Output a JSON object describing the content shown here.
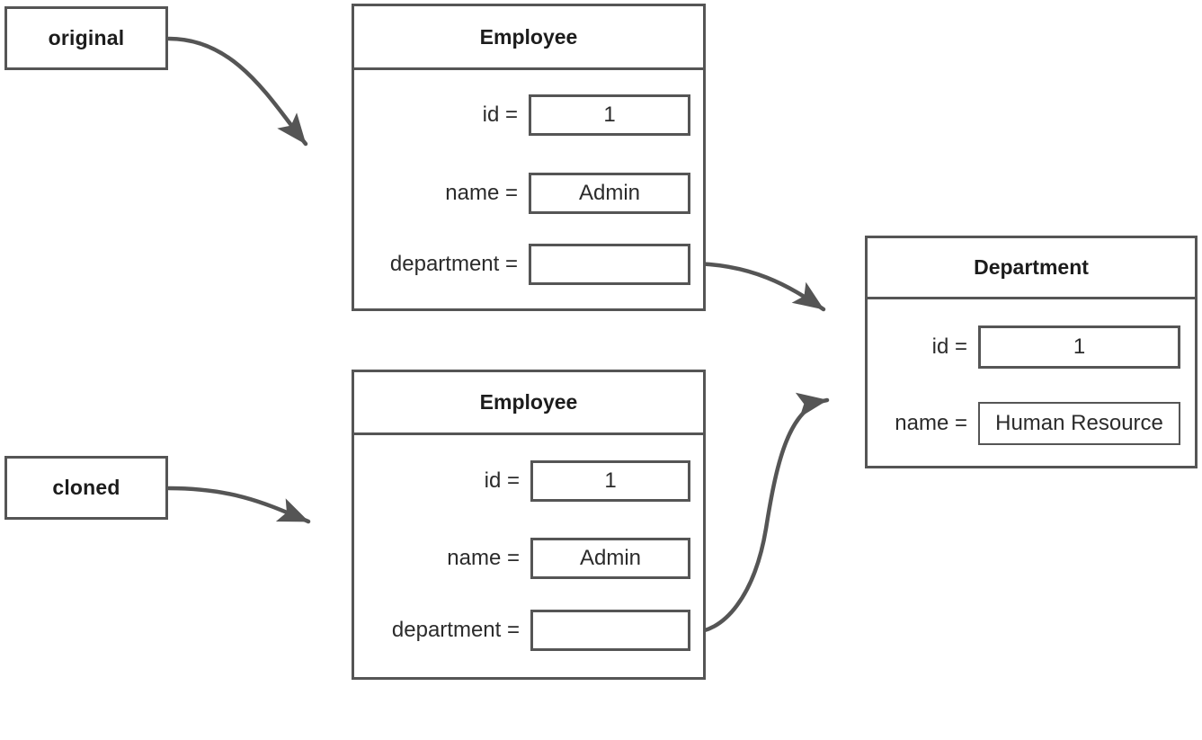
{
  "diagram": {
    "title": "Object reference diagram: original vs cloned Employee sharing a Department",
    "stroke_color": "#555555",
    "text_color": "#2b2b2b",
    "background_color": "#ffffff"
  },
  "tags": [
    {
      "id": "original",
      "label": "original"
    },
    {
      "id": "cloned",
      "label": "cloned"
    }
  ],
  "objects": [
    {
      "id": "employee-original",
      "title": "Employee",
      "fields": [
        {
          "label": "id =",
          "value": "1"
        },
        {
          "label": "name =",
          "value": "Admin"
        },
        {
          "label": "department =",
          "value": ""
        }
      ]
    },
    {
      "id": "employee-cloned",
      "title": "Employee",
      "fields": [
        {
          "label": "id =",
          "value": "1"
        },
        {
          "label": "name =",
          "value": "Admin"
        },
        {
          "label": "department =",
          "value": ""
        }
      ]
    },
    {
      "id": "department",
      "title": "Department",
      "fields": [
        {
          "label": "id =",
          "value": "1"
        },
        {
          "label": "name =",
          "value": "Human Resource"
        }
      ]
    }
  ],
  "edges": [
    {
      "id": "original-to-employee",
      "from": "original",
      "to": "employee-original"
    },
    {
      "id": "cloned-to-employee",
      "from": "cloned",
      "to": "employee-cloned"
    },
    {
      "id": "employee-original-department-to-department",
      "from": "employee-original.department",
      "to": "department"
    },
    {
      "id": "employee-cloned-department-to-department",
      "from": "employee-cloned.department",
      "to": "department"
    }
  ]
}
